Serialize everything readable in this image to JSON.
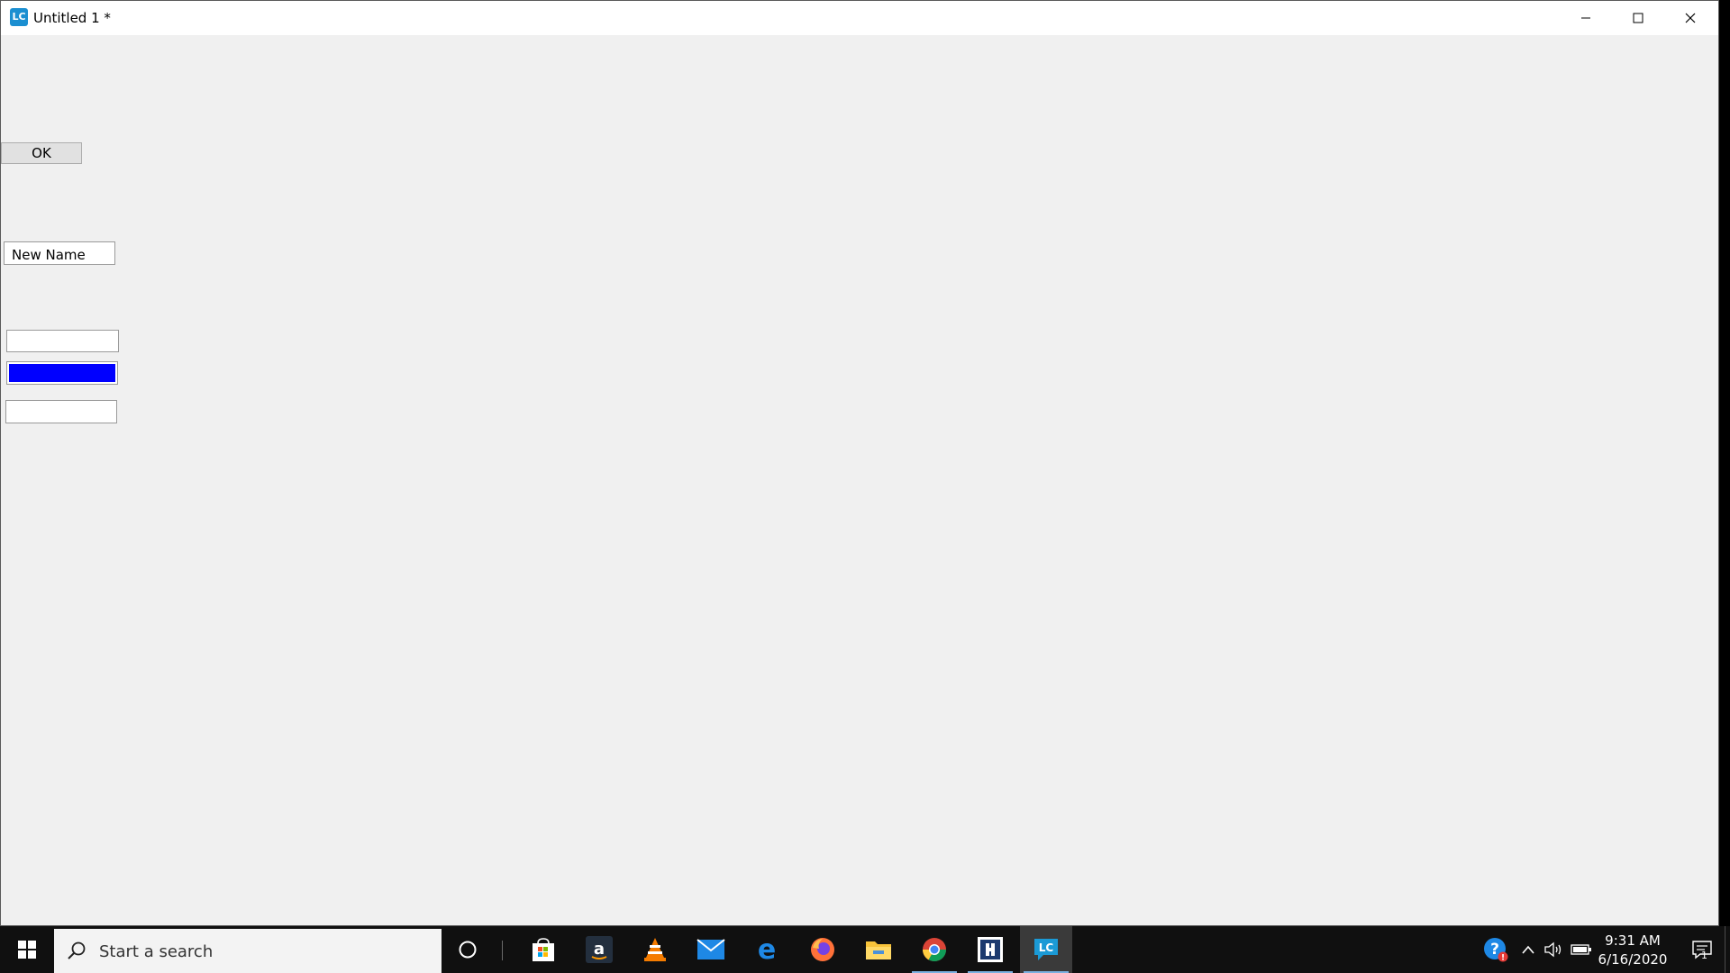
{
  "window": {
    "title": "Untitled 1 *",
    "app_icon_label": "LC",
    "app_icon": "livecode-app-icon",
    "caption_buttons": [
      "minimize-icon",
      "maximize-icon",
      "close-icon"
    ]
  },
  "content": {
    "ok_button_label": "OK",
    "name_field_value": "New Name",
    "empty_field_1_value": "",
    "color_swatch_color": "#0000ff",
    "empty_field_2_value": ""
  },
  "taskbar": {
    "search_placeholder": "Start a search",
    "pinned": [
      {
        "name": "microsoft-store-icon"
      },
      {
        "name": "amazon-icon",
        "glyph": "a"
      },
      {
        "name": "vlc-icon"
      },
      {
        "name": "mail-icon"
      },
      {
        "name": "edge-icon",
        "glyph": "e"
      },
      {
        "name": "firefox-icon"
      },
      {
        "name": "file-explorer-icon"
      },
      {
        "name": "chrome-icon"
      },
      {
        "name": "remote-desktop-icon"
      },
      {
        "name": "livecode-icon",
        "glyph": "LC"
      }
    ],
    "tray": {
      "help_icon": "help-icon",
      "chevron_icon": "chevron-up-icon",
      "volume_icon": "volume-icon",
      "battery_icon": "battery-icon"
    },
    "clock": {
      "time": "9:31 AM",
      "date": "6/16/2020"
    },
    "notification_count": "1"
  }
}
